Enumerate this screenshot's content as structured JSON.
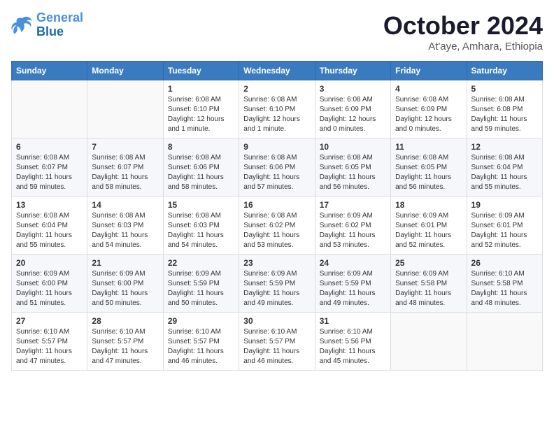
{
  "header": {
    "logo_line1": "General",
    "logo_line2": "Blue",
    "month": "October 2024",
    "location": "At'aye, Amhara, Ethiopia"
  },
  "weekdays": [
    "Sunday",
    "Monday",
    "Tuesday",
    "Wednesday",
    "Thursday",
    "Friday",
    "Saturday"
  ],
  "weeks": [
    [
      {
        "day": "",
        "info": ""
      },
      {
        "day": "",
        "info": ""
      },
      {
        "day": "1",
        "info": "Sunrise: 6:08 AM\nSunset: 6:10 PM\nDaylight: 12 hours\nand 1 minute."
      },
      {
        "day": "2",
        "info": "Sunrise: 6:08 AM\nSunset: 6:10 PM\nDaylight: 12 hours\nand 1 minute."
      },
      {
        "day": "3",
        "info": "Sunrise: 6:08 AM\nSunset: 6:09 PM\nDaylight: 12 hours\nand 0 minutes."
      },
      {
        "day": "4",
        "info": "Sunrise: 6:08 AM\nSunset: 6:09 PM\nDaylight: 12 hours\nand 0 minutes."
      },
      {
        "day": "5",
        "info": "Sunrise: 6:08 AM\nSunset: 6:08 PM\nDaylight: 11 hours\nand 59 minutes."
      }
    ],
    [
      {
        "day": "6",
        "info": "Sunrise: 6:08 AM\nSunset: 6:07 PM\nDaylight: 11 hours\nand 59 minutes."
      },
      {
        "day": "7",
        "info": "Sunrise: 6:08 AM\nSunset: 6:07 PM\nDaylight: 11 hours\nand 58 minutes."
      },
      {
        "day": "8",
        "info": "Sunrise: 6:08 AM\nSunset: 6:06 PM\nDaylight: 11 hours\nand 58 minutes."
      },
      {
        "day": "9",
        "info": "Sunrise: 6:08 AM\nSunset: 6:06 PM\nDaylight: 11 hours\nand 57 minutes."
      },
      {
        "day": "10",
        "info": "Sunrise: 6:08 AM\nSunset: 6:05 PM\nDaylight: 11 hours\nand 56 minutes."
      },
      {
        "day": "11",
        "info": "Sunrise: 6:08 AM\nSunset: 6:05 PM\nDaylight: 11 hours\nand 56 minutes."
      },
      {
        "day": "12",
        "info": "Sunrise: 6:08 AM\nSunset: 6:04 PM\nDaylight: 11 hours\nand 55 minutes."
      }
    ],
    [
      {
        "day": "13",
        "info": "Sunrise: 6:08 AM\nSunset: 6:04 PM\nDaylight: 11 hours\nand 55 minutes."
      },
      {
        "day": "14",
        "info": "Sunrise: 6:08 AM\nSunset: 6:03 PM\nDaylight: 11 hours\nand 54 minutes."
      },
      {
        "day": "15",
        "info": "Sunrise: 6:08 AM\nSunset: 6:03 PM\nDaylight: 11 hours\nand 54 minutes."
      },
      {
        "day": "16",
        "info": "Sunrise: 6:08 AM\nSunset: 6:02 PM\nDaylight: 11 hours\nand 53 minutes."
      },
      {
        "day": "17",
        "info": "Sunrise: 6:09 AM\nSunset: 6:02 PM\nDaylight: 11 hours\nand 53 minutes."
      },
      {
        "day": "18",
        "info": "Sunrise: 6:09 AM\nSunset: 6:01 PM\nDaylight: 11 hours\nand 52 minutes."
      },
      {
        "day": "19",
        "info": "Sunrise: 6:09 AM\nSunset: 6:01 PM\nDaylight: 11 hours\nand 52 minutes."
      }
    ],
    [
      {
        "day": "20",
        "info": "Sunrise: 6:09 AM\nSunset: 6:00 PM\nDaylight: 11 hours\nand 51 minutes."
      },
      {
        "day": "21",
        "info": "Sunrise: 6:09 AM\nSunset: 6:00 PM\nDaylight: 11 hours\nand 50 minutes."
      },
      {
        "day": "22",
        "info": "Sunrise: 6:09 AM\nSunset: 5:59 PM\nDaylight: 11 hours\nand 50 minutes."
      },
      {
        "day": "23",
        "info": "Sunrise: 6:09 AM\nSunset: 5:59 PM\nDaylight: 11 hours\nand 49 minutes."
      },
      {
        "day": "24",
        "info": "Sunrise: 6:09 AM\nSunset: 5:59 PM\nDaylight: 11 hours\nand 49 minutes."
      },
      {
        "day": "25",
        "info": "Sunrise: 6:09 AM\nSunset: 5:58 PM\nDaylight: 11 hours\nand 48 minutes."
      },
      {
        "day": "26",
        "info": "Sunrise: 6:10 AM\nSunset: 5:58 PM\nDaylight: 11 hours\nand 48 minutes."
      }
    ],
    [
      {
        "day": "27",
        "info": "Sunrise: 6:10 AM\nSunset: 5:57 PM\nDaylight: 11 hours\nand 47 minutes."
      },
      {
        "day": "28",
        "info": "Sunrise: 6:10 AM\nSunset: 5:57 PM\nDaylight: 11 hours\nand 47 minutes."
      },
      {
        "day": "29",
        "info": "Sunrise: 6:10 AM\nSunset: 5:57 PM\nDaylight: 11 hours\nand 46 minutes."
      },
      {
        "day": "30",
        "info": "Sunrise: 6:10 AM\nSunset: 5:57 PM\nDaylight: 11 hours\nand 46 minutes."
      },
      {
        "day": "31",
        "info": "Sunrise: 6:10 AM\nSunset: 5:56 PM\nDaylight: 11 hours\nand 45 minutes."
      },
      {
        "day": "",
        "info": ""
      },
      {
        "day": "",
        "info": ""
      }
    ]
  ]
}
